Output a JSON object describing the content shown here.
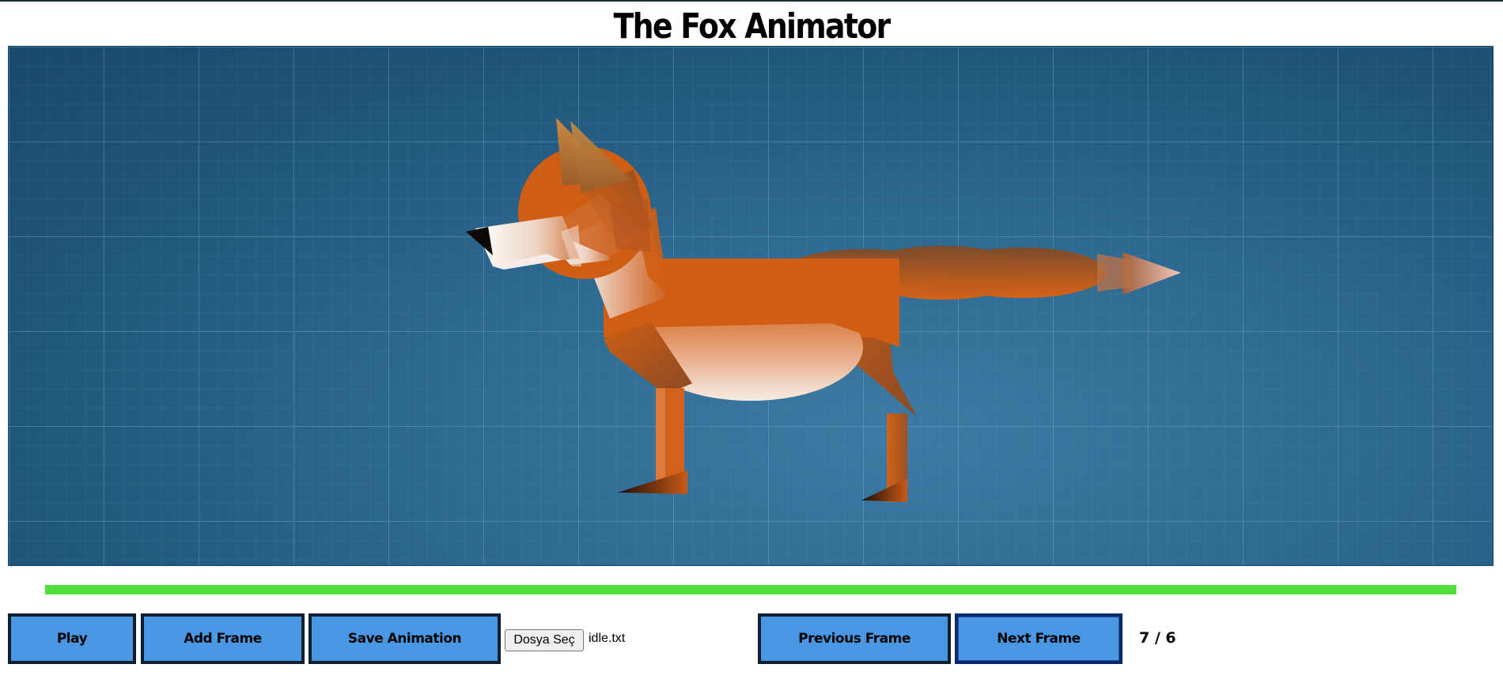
{
  "app": {
    "title": "The Fox Animator"
  },
  "canvas": {
    "background_color": "#2d6890",
    "grid_color": "#6fa3c8",
    "subject": "fox-figure"
  },
  "timeline": {
    "color": "#4fe13a"
  },
  "toolbar": {
    "play_label": "Play",
    "add_frame_label": "Add Frame",
    "save_animation_label": "Save Animation",
    "file_button_label": "Dosya Seç",
    "file_name": "idle.txt",
    "previous_frame_label": "Previous Frame",
    "next_frame_label": "Next Frame",
    "frame_counter": "7 / 6",
    "button_color": "#4a98e3"
  }
}
